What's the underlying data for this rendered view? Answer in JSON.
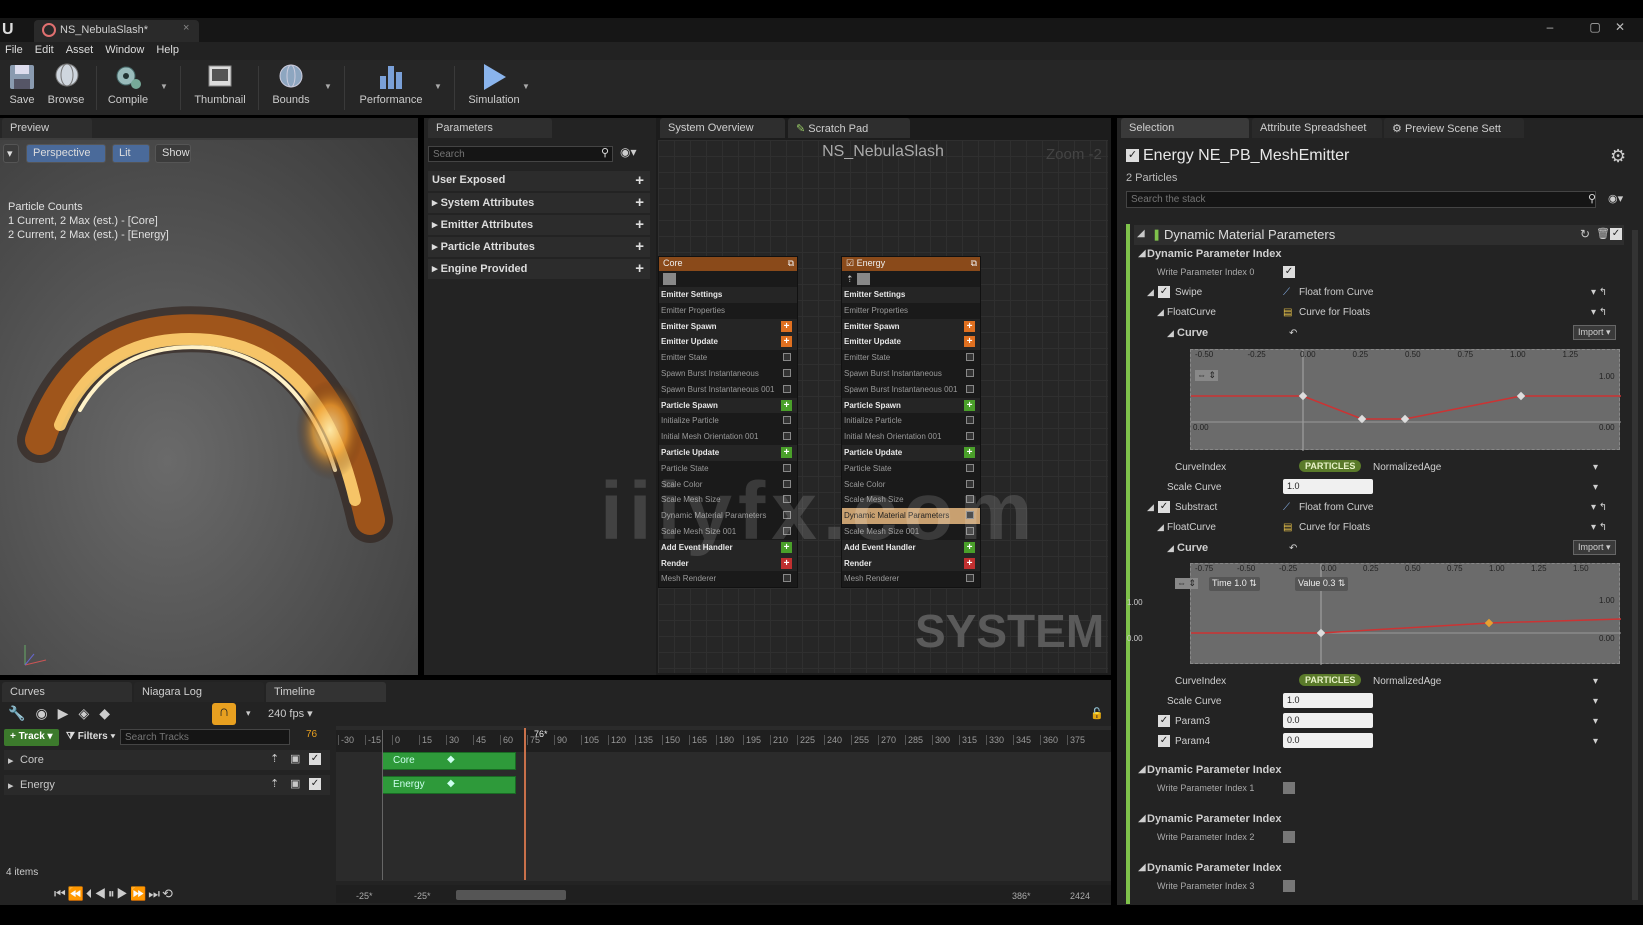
{
  "window": {
    "tab_title": "NS_NebulaSlash*"
  },
  "menu": [
    "File",
    "Edit",
    "Asset",
    "Window",
    "Help"
  ],
  "toolbar": {
    "save": "Save",
    "browse": "Browse",
    "compile": "Compile",
    "thumbnail": "Thumbnail",
    "bounds": "Bounds",
    "performance": "Performance",
    "simulation": "Simulation"
  },
  "preview": {
    "tab": "Preview",
    "perspective": "Perspective",
    "lit": "Lit",
    "show": "Show",
    "counts_title": "Particle Counts",
    "count1": "1 Current, 2 Max (est.) - [Core]",
    "count2": "2 Current, 2 Max (est.) - [Energy]"
  },
  "parameters": {
    "tab": "Parameters",
    "search_placeholder": "Search",
    "sections": [
      "User Exposed",
      "System Attributes",
      "Emitter Attributes",
      "Particle Attributes",
      "Engine Provided"
    ]
  },
  "graph": {
    "tab1": "System Overview",
    "tab2": "Scratch Pad",
    "title": "NS_NebulaSlash",
    "zoom": "Zoom -2",
    "system_label": "SYSTEM",
    "watermark": "iiiyfx.com"
  },
  "nodes": {
    "core": {
      "title": "Core",
      "rows": [
        {
          "t": "Emitter Settings",
          "b": true
        },
        {
          "t": "Emitter Properties"
        },
        {
          "t": "Emitter Spawn",
          "b": true,
          "p": "o"
        },
        {
          "t": "Emitter Update",
          "b": true,
          "p": "o"
        },
        {
          "t": "Emitter State",
          "c": true
        },
        {
          "t": "Spawn Burst Instantaneous",
          "c": true
        },
        {
          "t": "Spawn Burst Instantaneous 001",
          "c": true
        },
        {
          "t": "Particle Spawn",
          "b": true,
          "p": "g"
        },
        {
          "t": "Initialize Particle",
          "c": true
        },
        {
          "t": "Initial Mesh Orientation 001",
          "c": true
        },
        {
          "t": "Particle Update",
          "b": true,
          "p": "g"
        },
        {
          "t": "Particle State",
          "c": true
        },
        {
          "t": "Scale Color",
          "c": true
        },
        {
          "t": "Scale Mesh Size",
          "c": true
        },
        {
          "t": "Dynamic Material Parameters",
          "c": true
        },
        {
          "t": "Scale Mesh Size 001",
          "c": true
        },
        {
          "t": "Add Event Handler",
          "b": true,
          "p": "g"
        },
        {
          "t": "Render",
          "b": true,
          "p": "r"
        },
        {
          "t": "Mesh Renderer",
          "c": true
        }
      ]
    },
    "energy": {
      "title": "Energy",
      "rows": [
        {
          "t": "Emitter Settings",
          "b": true
        },
        {
          "t": "Emitter Properties"
        },
        {
          "t": "Emitter Spawn",
          "b": true,
          "p": "o"
        },
        {
          "t": "Emitter Update",
          "b": true,
          "p": "o"
        },
        {
          "t": "Emitter State",
          "c": true
        },
        {
          "t": "Spawn Burst Instantaneous",
          "c": true
        },
        {
          "t": "Spawn Burst Instantaneous 001",
          "c": true
        },
        {
          "t": "Particle Spawn",
          "b": true,
          "p": "g"
        },
        {
          "t": "Initialize Particle",
          "c": true
        },
        {
          "t": "Initial Mesh Orientation 001",
          "c": true
        },
        {
          "t": "Particle Update",
          "b": true,
          "p": "g"
        },
        {
          "t": "Particle State",
          "c": true
        },
        {
          "t": "Scale Color",
          "c": true
        },
        {
          "t": "Scale Mesh Size",
          "c": true
        },
        {
          "t": "Dynamic Material Parameters",
          "c": true,
          "h": true
        },
        {
          "t": "Scale Mesh Size 001",
          "c": true
        },
        {
          "t": "Add Event Handler",
          "b": true,
          "p": "g"
        },
        {
          "t": "Render",
          "b": true,
          "p": "r"
        },
        {
          "t": "Mesh Renderer",
          "c": true
        }
      ]
    }
  },
  "selection": {
    "tab1": "Selection",
    "tab2": "Attribute Spreadsheet",
    "tab3": "Preview Scene Sett",
    "emitter_title": "Energy NE_PB_MeshEmitter",
    "particles": "2 Particles",
    "search_placeholder": "Search the stack",
    "module": "Dynamic Material Parameters",
    "dpi0": "Dynamic Parameter Index",
    "write0": "Write Parameter Index 0",
    "swipe": "Swipe",
    "float_from_curve": "Float from Curve",
    "floatcurve": "FloatCurve",
    "curve_for_floats": "Curve for Floats",
    "curve": "Curve",
    "import": "Import",
    "curveindex": "CurveIndex",
    "particles_badge": "PARTICLES",
    "normalized_age": "NormalizedAge",
    "scale_curve": "Scale Curve",
    "scale_val": "1.0",
    "substract": "Substract",
    "time_label": "Time",
    "time_val": "1.0",
    "value_label": "Value",
    "value_val": "0.3",
    "param3": "Param3",
    "param3_val": "0.0",
    "param4": "Param4",
    "param4_val": "0.0",
    "dpi1": "Dynamic Parameter Index",
    "write1": "Write Parameter Index 1",
    "dpi2": "Dynamic Parameter Index",
    "write2": "Write Parameter Index 2",
    "dpi3": "Dynamic Parameter Index",
    "write3": "Write Parameter Index 3",
    "curve1_ticks": [
      "-0.50",
      "-0.25",
      "0.00",
      "0.25",
      "0.50",
      "0.75",
      "1.00",
      "1.25"
    ],
    "curve2_ticks": [
      "-0.75",
      "-0.50",
      "-0.25",
      "0.00",
      "0.25",
      "0.50",
      "0.75",
      "1.00",
      "1.25",
      "1.50"
    ],
    "y_one": "1.00",
    "y_zero": "0.00"
  },
  "bottom": {
    "tab1": "Curves",
    "tab2": "Niagara Log",
    "tab3": "Timeline",
    "fps": "240 fps",
    "track": "Track",
    "filters": "Filters",
    "search_placeholder": "Search Tracks",
    "playhead": "76",
    "playhead_mark": "76*",
    "tracks": [
      "Core",
      "Energy"
    ],
    "items": "4 items",
    "range_left": "-25*",
    "range_left2": "-25*",
    "range_right": "386*",
    "range_right2": "2424",
    "ticks": [
      "-30",
      "-15",
      "0",
      "15",
      "30",
      "45",
      "60",
      "75",
      "90",
      "105",
      "120",
      "135",
      "150",
      "165",
      "180",
      "195",
      "210",
      "225",
      "240",
      "255",
      "270",
      "285",
      "300",
      "315",
      "330",
      "345",
      "360",
      "375"
    ]
  }
}
